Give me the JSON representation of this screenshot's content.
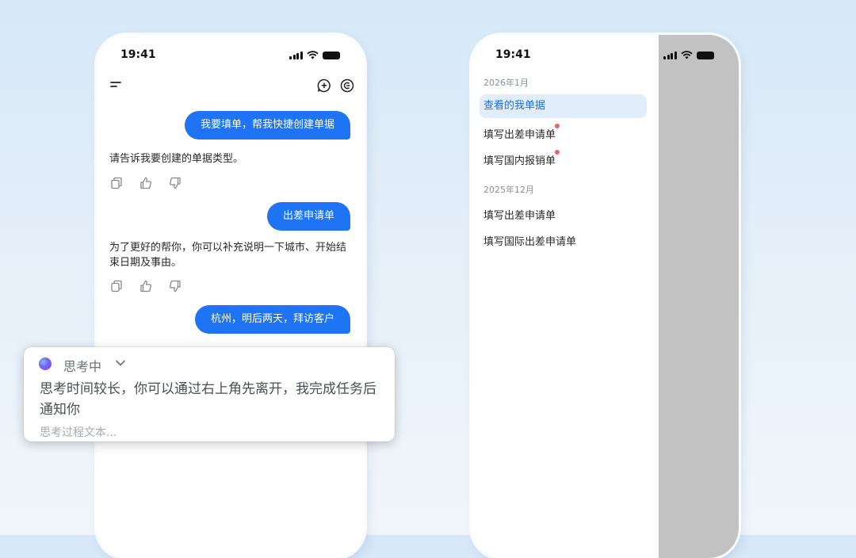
{
  "chat_screen": {
    "status_time": "19:41",
    "messages": [
      {
        "role": "user",
        "text": "我要填单，帮我快捷创建单据"
      },
      {
        "role": "assistant",
        "text": "请告诉我要创建的单据类型。"
      },
      {
        "role": "user",
        "text": "出差申请单"
      },
      {
        "role": "assistant",
        "text": "为了更好的帮你，你可以补充说明一下城市、开始结束日期及事由。"
      },
      {
        "role": "user",
        "text": "杭州，明后两天，拜访客户"
      }
    ],
    "icons": {
      "menu": "menu-icon",
      "new_chat": "new-chat-icon",
      "clear": "clear-context-icon",
      "copy": "copy-icon",
      "like": "thumbs-up-icon",
      "dislike": "thumbs-down-icon"
    },
    "accent_color": "#1f73f5"
  },
  "thinking": {
    "status": "思考中",
    "message": "思考时间较长，你可以通过右上角先离开，我完成任务后通知你",
    "process_placeholder": "思考过程文本..."
  },
  "history_screen": {
    "status_time": "19:41",
    "groups": [
      {
        "label": "2026年1月",
        "items": [
          {
            "label": "查看的我单据",
            "active": true,
            "badge": false
          },
          {
            "label": "填写出差申请单",
            "active": false,
            "badge": true
          },
          {
            "label": "填写国内报销单",
            "active": false,
            "badge": true
          }
        ]
      },
      {
        "label": "2025年12月",
        "items": [
          {
            "label": "填写出差申请单",
            "active": false,
            "badge": false
          },
          {
            "label": "填写国际出差申请单",
            "active": false,
            "badge": false
          }
        ]
      }
    ],
    "badge_color": "#f0625c"
  }
}
